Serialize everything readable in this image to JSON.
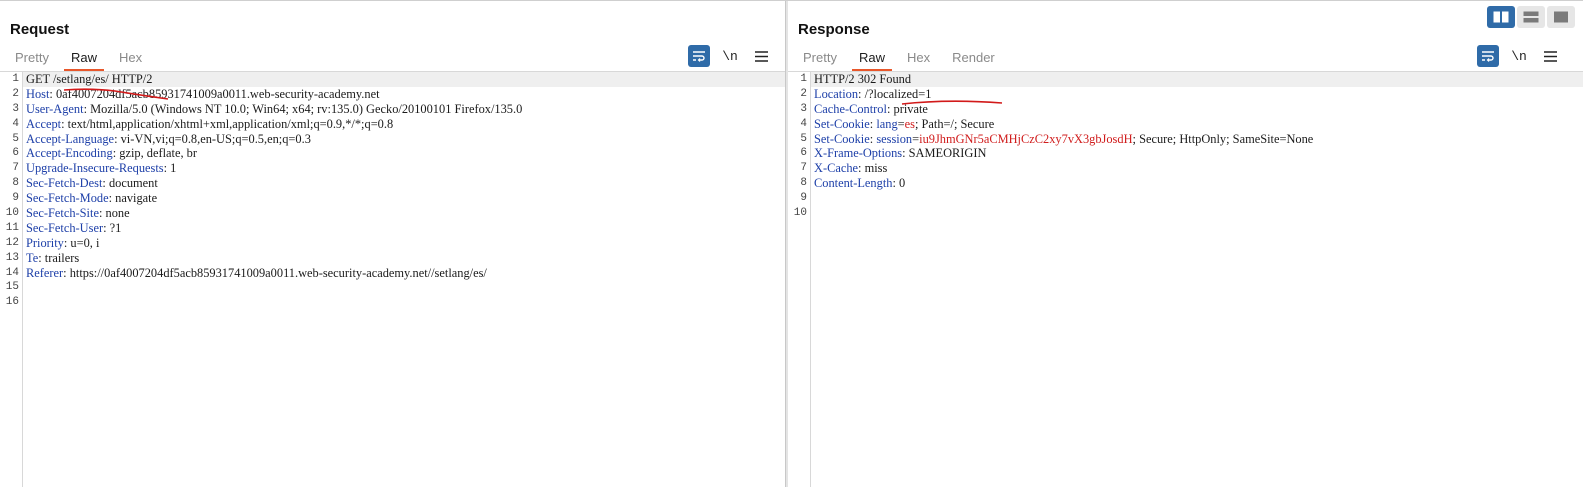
{
  "request": {
    "title": "Request",
    "tabs": [
      {
        "label": "Pretty",
        "active": false
      },
      {
        "label": "Raw",
        "active": true
      },
      {
        "label": "Hex",
        "active": false
      }
    ],
    "tools": {
      "wrap_icon": "wrap-lines-icon",
      "newline_label": "\\n",
      "menu_icon": "hamburger-menu-icon"
    },
    "lines": [
      {
        "n": "1",
        "plain": "GET /setlang/es/ HTTP/2"
      },
      {
        "n": "2",
        "key": "Host",
        "value": "0af4007204df5acb85931741009a0011.web-security-academy.net"
      },
      {
        "n": "3",
        "key": "User-Agent",
        "value": "Mozilla/5.0 (Windows NT 10.0; Win64; x64; rv:135.0) Gecko/20100101 Firefox/135.0"
      },
      {
        "n": "4",
        "key": "Accept",
        "value": "text/html,application/xhtml+xml,application/xml;q=0.9,*/*;q=0.8"
      },
      {
        "n": "5",
        "key": "Accept-Language",
        "value": "vi-VN,vi;q=0.8,en-US;q=0.5,en;q=0.3"
      },
      {
        "n": "6",
        "key": "Accept-Encoding",
        "value": "gzip, deflate, br"
      },
      {
        "n": "7",
        "key": "Upgrade-Insecure-Requests",
        "value": "1"
      },
      {
        "n": "8",
        "key": "Sec-Fetch-Dest",
        "value": "document"
      },
      {
        "n": "9",
        "key": "Sec-Fetch-Mode",
        "value": "navigate"
      },
      {
        "n": "10",
        "key": "Sec-Fetch-Site",
        "value": "none"
      },
      {
        "n": "11",
        "key": "Sec-Fetch-User",
        "value": "?1"
      },
      {
        "n": "12",
        "key": "Priority",
        "value": "u=0, i"
      },
      {
        "n": "13",
        "key": "Te",
        "value": "trailers"
      },
      {
        "n": "14",
        "key": "Referer",
        "value": "https://0af4007204df5acb85931741009a0011.web-security-academy.net//setlang/es/"
      },
      {
        "n": "15",
        "plain": ""
      },
      {
        "n": "16",
        "plain": ""
      }
    ]
  },
  "response": {
    "title": "Response",
    "tabs": [
      {
        "label": "Pretty",
        "active": false
      },
      {
        "label": "Raw",
        "active": true
      },
      {
        "label": "Hex",
        "active": false
      },
      {
        "label": "Render",
        "active": false
      }
    ],
    "tools": {
      "wrap_icon": "wrap-lines-icon",
      "newline_label": "\\n",
      "menu_icon": "hamburger-menu-icon"
    },
    "lines": [
      {
        "n": "1",
        "plain": "HTTP/2 302 Found"
      },
      {
        "n": "2",
        "key": "Location",
        "value": "/?localized=1"
      },
      {
        "n": "3",
        "key": "Cache-Control",
        "value": "private"
      },
      {
        "n": "4",
        "key": "Set-Cookie",
        "ck": "lang",
        "cv": "es",
        "rest": "; Path=/; Secure"
      },
      {
        "n": "5",
        "key": "Set-Cookie",
        "ck": "session",
        "cv": "iu9JhmGNr5aCMHjCzC2xy7vX3gbJosdH",
        "rest": "; Secure; HttpOnly; SameSite=None"
      },
      {
        "n": "6",
        "key": "X-Frame-Options",
        "value": "SAMEORIGIN"
      },
      {
        "n": "7",
        "key": "X-Cache",
        "value": "miss"
      },
      {
        "n": "8",
        "key": "Content-Length",
        "value": "0"
      },
      {
        "n": "9",
        "plain": ""
      },
      {
        "n": "10",
        "plain": ""
      }
    ]
  },
  "layout_toggle": [
    {
      "icon": "side-by-side-layout-icon",
      "active": true
    },
    {
      "icon": "top-bottom-layout-icon",
      "active": false
    },
    {
      "icon": "single-pane-layout-icon",
      "active": false
    }
  ],
  "colors": {
    "header_key": "#1d3fa8",
    "cookie_value": "#d01c1c",
    "accent": "#e8572b",
    "tool_active": "#2f6ba8"
  }
}
